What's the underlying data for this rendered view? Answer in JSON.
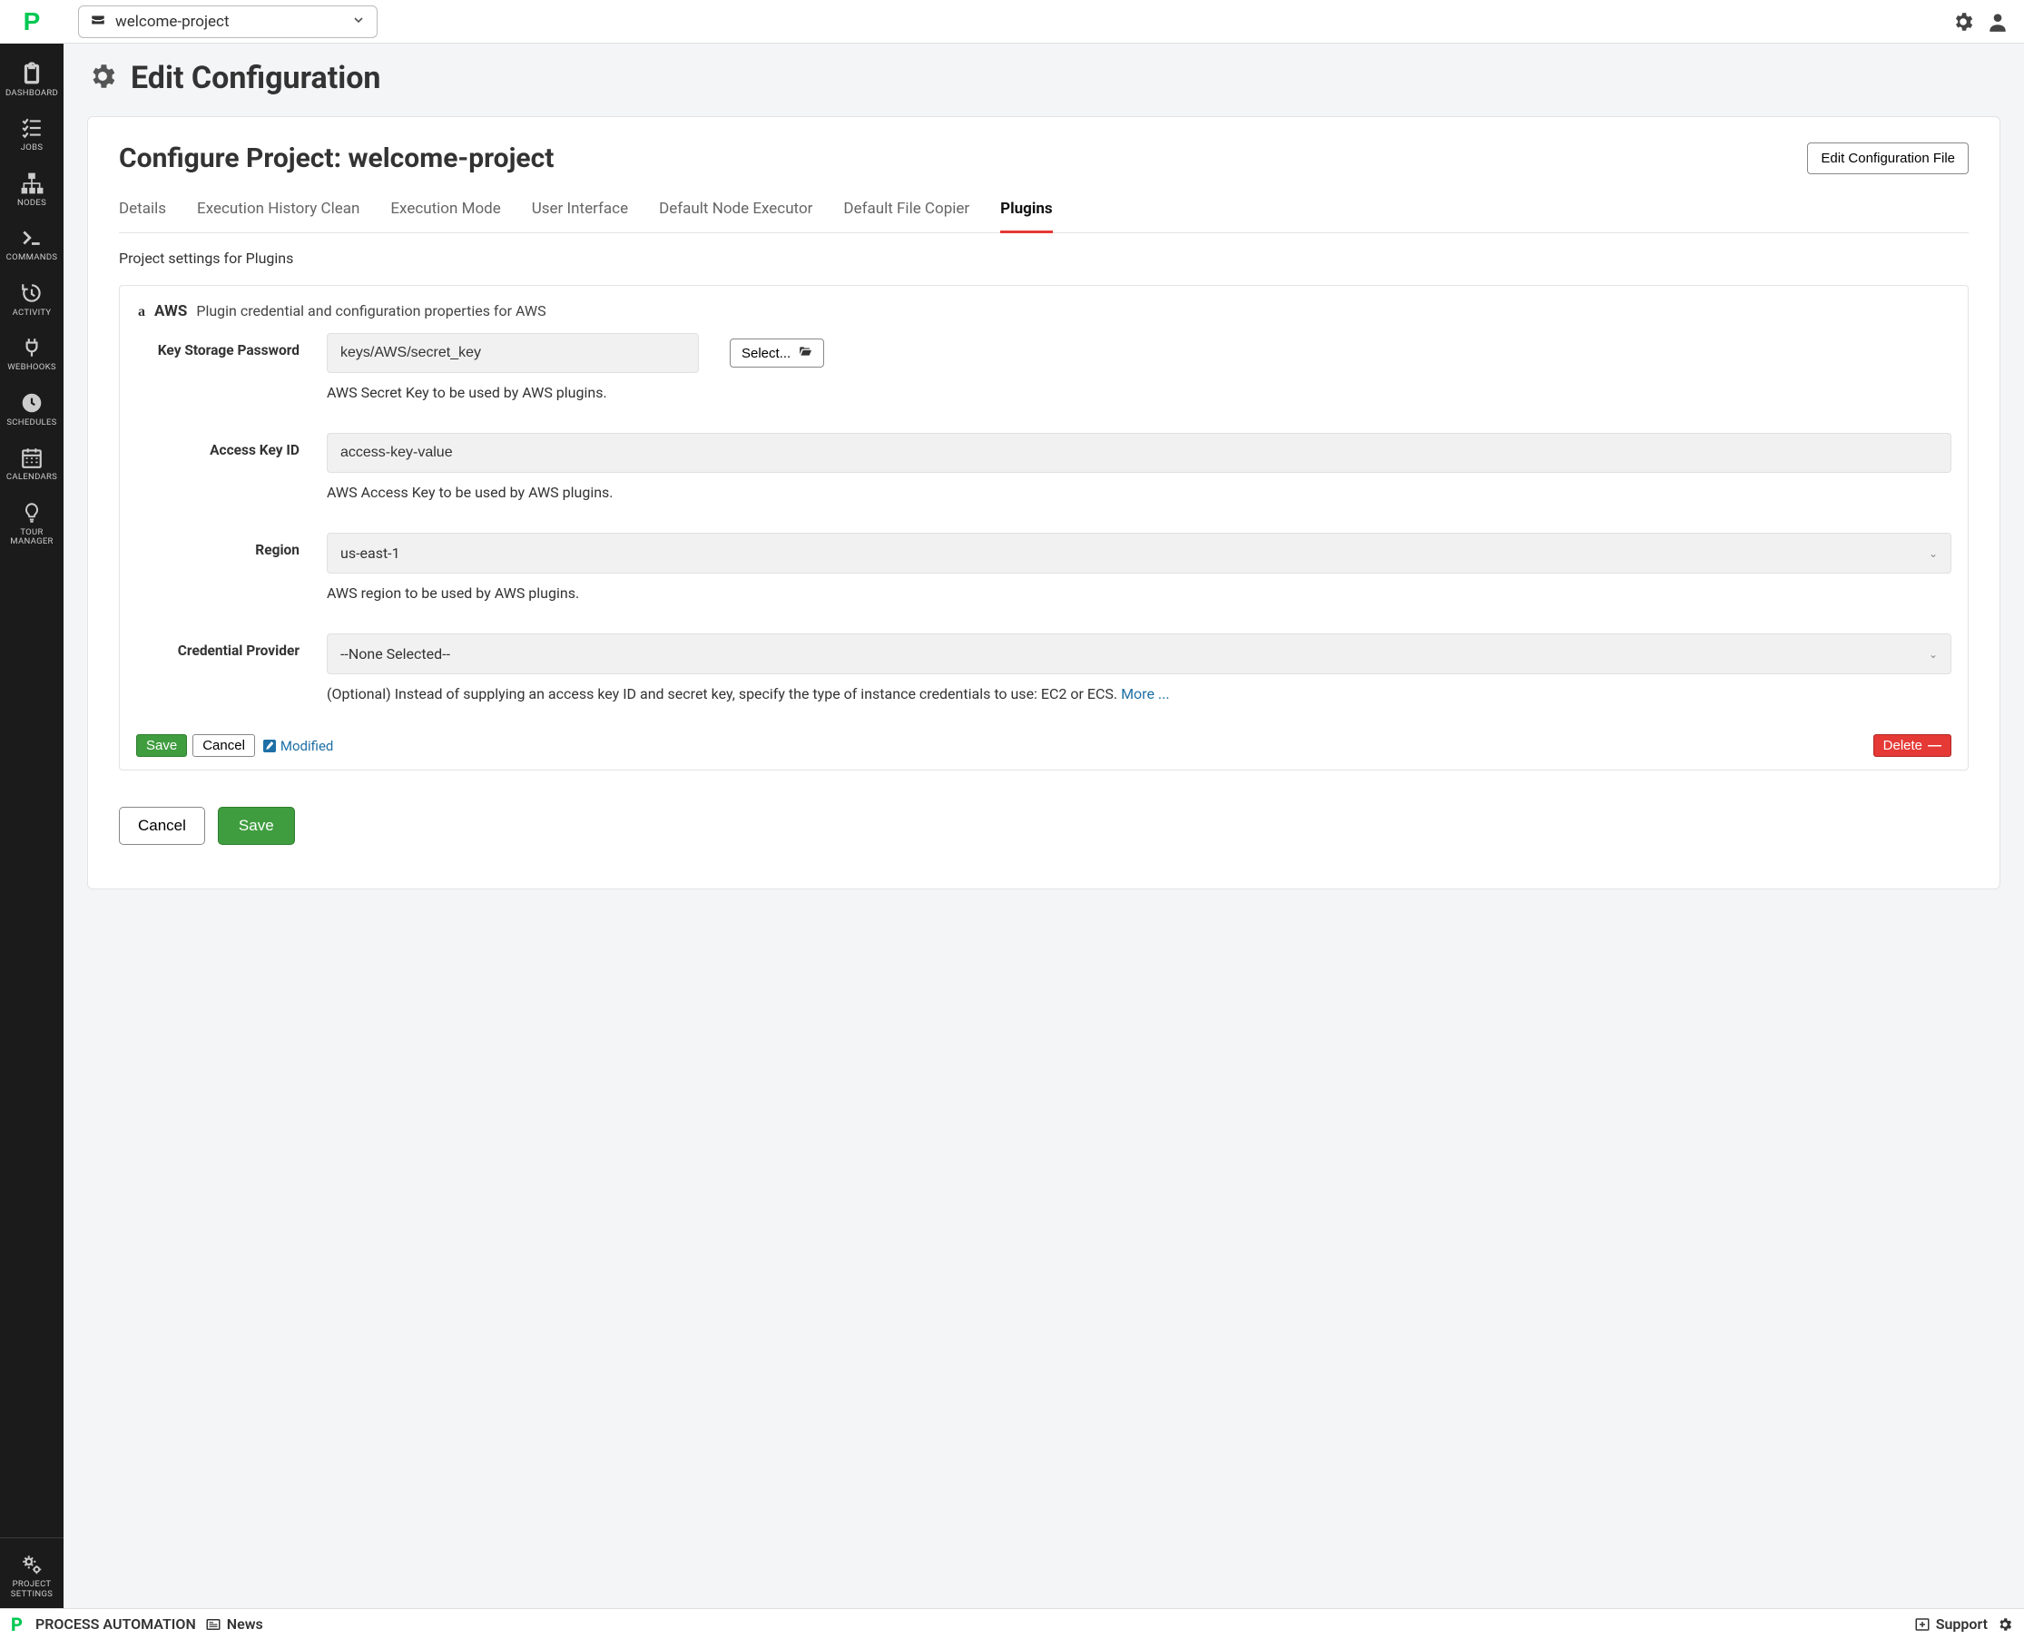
{
  "project_selector": {
    "name": "welcome-project"
  },
  "sidebar": {
    "items": [
      {
        "label": "DASHBOARD"
      },
      {
        "label": "JOBS"
      },
      {
        "label": "NODES"
      },
      {
        "label": "COMMANDS"
      },
      {
        "label": "ACTIVITY"
      },
      {
        "label": "WEBHOOKS"
      },
      {
        "label": "SCHEDULES"
      },
      {
        "label": "CALENDARS"
      },
      {
        "label": "TOUR\nMANAGER"
      }
    ],
    "bottom": {
      "label": "PROJECT\nSETTINGS"
    }
  },
  "page": {
    "title": "Edit Configuration",
    "card_title": "Configure Project: welcome-project",
    "edit_file_label": "Edit Configuration File",
    "tabs": [
      "Details",
      "Execution History Clean",
      "Execution Mode",
      "User Interface",
      "Default Node Executor",
      "Default File Copier",
      "Plugins"
    ],
    "active_tab": "Plugins",
    "subhead": "Project settings for Plugins"
  },
  "plugin": {
    "icon_text": "a",
    "name": "AWS",
    "description": "Plugin credential and configuration properties for AWS",
    "select_button": "Select...",
    "fields": {
      "key_storage": {
        "label": "Key Storage Password",
        "value": "keys/AWS/secret_key",
        "help": "AWS Secret Key to be used by AWS plugins."
      },
      "access_key": {
        "label": "Access Key ID",
        "value": "access-key-value",
        "help": "AWS Access Key to be used by AWS plugins."
      },
      "region": {
        "label": "Region",
        "value": "us-east-1",
        "help": "AWS region to be used by AWS plugins."
      },
      "cred_provider": {
        "label": "Credential Provider",
        "value": "--None Selected--",
        "help": "(Optional) Instead of supplying an access key ID and secret key, specify the type of instance credentials to use: EC2 or ECS.  ",
        "more": "More ..."
      }
    },
    "panel_actions": {
      "save": "Save",
      "cancel": "Cancel",
      "modified": "Modified",
      "delete": "Delete"
    }
  },
  "page_actions": {
    "cancel": "Cancel",
    "save": "Save"
  },
  "footer": {
    "brand": "PROCESS AUTOMATION",
    "news": "News",
    "support": "Support"
  }
}
